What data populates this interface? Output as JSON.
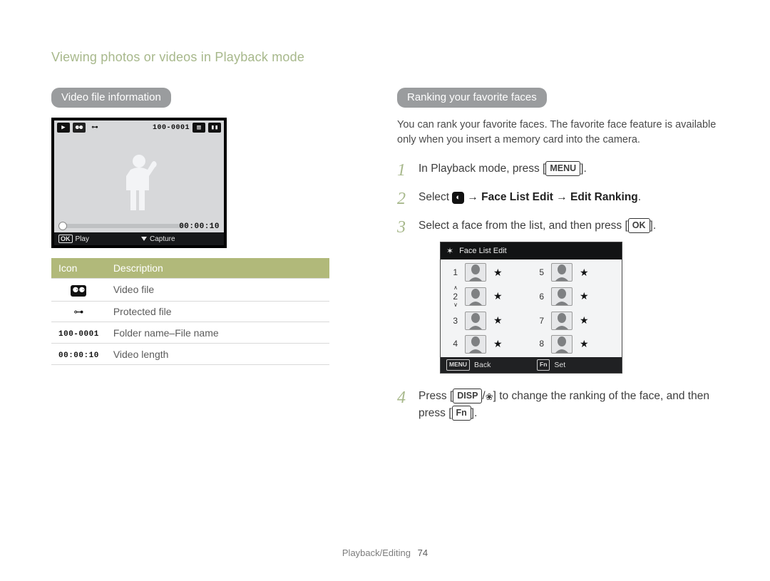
{
  "breadcrumb": "Viewing photos or videos in Playback mode",
  "left": {
    "pill": "Video file information",
    "lcd": {
      "file_code": "100-0001",
      "duration": "00:00:10",
      "bottom_left_key": "OK",
      "bottom_left_label": "Play",
      "bottom_right_label": "Capture"
    },
    "table": {
      "head_icon": "Icon",
      "head_desc": "Description",
      "rows": [
        {
          "icon_type": "camcorder",
          "icon_text": "",
          "desc": "Video file"
        },
        {
          "icon_type": "key",
          "icon_text": "⊶",
          "desc": "Protected file"
        },
        {
          "icon_type": "mono",
          "icon_text": "100-0001",
          "desc": "Folder name–File name"
        },
        {
          "icon_type": "mono",
          "icon_text": "00:00:10",
          "desc": "Video length"
        }
      ]
    }
  },
  "right": {
    "pill": "Ranking your favorite faces",
    "intro": "You can rank your favorite faces. The favorite face feature is available only when you insert a memory card into the camera.",
    "steps": {
      "s1_a": "In Playback mode, press [",
      "s1_btn": "MENU",
      "s1_b": "].",
      "s2_a": "Select ",
      "s2_bold": " → Face List Edit → Edit Ranking",
      "s2_b": ".",
      "s3_a": "Select a face from the list, and then press [",
      "s3_btn": "OK",
      "s3_b": "].",
      "s4_a": "Press [",
      "s4_btn1": "DISP",
      "s4_sep": "/",
      "s4_b": "] to change the ranking of the face, and then press [",
      "s4_btn2": "Fn",
      "s4_c": "]."
    },
    "facelcd": {
      "title": "Face List Edit",
      "back_key": "MENU",
      "back_label": "Back",
      "set_key": "Fn",
      "set_label": "Set",
      "items": [
        "1",
        "2",
        "3",
        "4",
        "5",
        "6",
        "7",
        "8"
      ],
      "selected_index": 1
    }
  },
  "footer": {
    "section": "Playback/Editing",
    "page": "74"
  }
}
